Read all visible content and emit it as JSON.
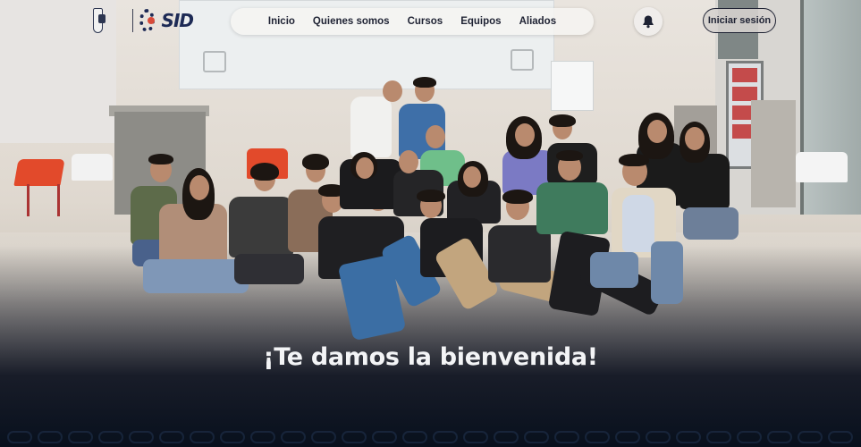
{
  "brand": {
    "institution_logo_icon": "university-crest-icon",
    "logo_icon": "gear-logo-icon",
    "logo_text": "SID"
  },
  "nav": {
    "items": [
      {
        "label": "Inicio"
      },
      {
        "label": "Quienes somos"
      },
      {
        "label": "Cursos"
      },
      {
        "label": "Equipos"
      },
      {
        "label": "Aliados"
      }
    ]
  },
  "header": {
    "notifications_icon": "bell-icon",
    "login_label": "Iniciar sesión"
  },
  "hero": {
    "title": "¡Te damos la bienvenida!"
  },
  "colors": {
    "nav_text": "#1e2233",
    "brand_blue": "#1d2a55",
    "hero_title": "#f3f4f6",
    "footer_dark": "#08101d"
  }
}
